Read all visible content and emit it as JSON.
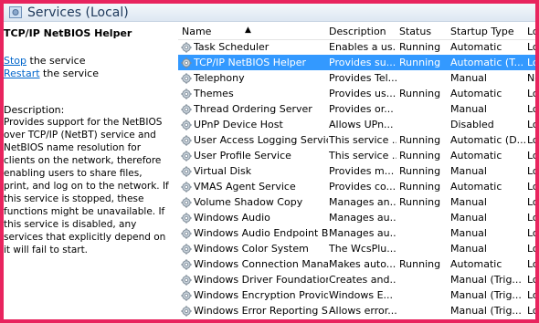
{
  "window": {
    "title": "Services (Local)"
  },
  "selected_service": {
    "name": "TCP/IP NetBIOS Helper",
    "action_stop_link": "Stop",
    "action_stop_suffix": " the service",
    "action_restart_link": "Restart",
    "action_restart_suffix": " the service",
    "description_heading": "Description:",
    "description": "Provides support for the NetBIOS over TCP/IP (NetBT) service and NetBIOS name resolution for clients on the network, therefore enabling users to share files, print, and log on to the network. If this service is stopped, these functions might be unavailable. If this service is disabled, any services that explicitly depend on it will fail to start."
  },
  "columns": {
    "name": "Name",
    "description": "Description",
    "status": "Status",
    "startup_type": "Startup Type",
    "log_on_as": "Lo"
  },
  "rows": [
    {
      "name": "Task Scheduler",
      "description": "Enables a us...",
      "status": "Running",
      "startup": "Automatic",
      "logon": "Lo"
    },
    {
      "name": "TCP/IP NetBIOS Helper",
      "description": "Provides su...",
      "status": "Running",
      "startup": "Automatic (T...",
      "logon": "Lo",
      "selected": true
    },
    {
      "name": "Telephony",
      "description": "Provides Tel...",
      "status": "",
      "startup": "Manual",
      "logon": "Ne"
    },
    {
      "name": "Themes",
      "description": "Provides us...",
      "status": "Running",
      "startup": "Automatic",
      "logon": "Lo"
    },
    {
      "name": "Thread Ordering Server",
      "description": "Provides or...",
      "status": "",
      "startup": "Manual",
      "logon": "Lo"
    },
    {
      "name": "UPnP Device Host",
      "description": "Allows UPn...",
      "status": "",
      "startup": "Disabled",
      "logon": "Lo"
    },
    {
      "name": "User Access Logging Service",
      "description": "This service ...",
      "status": "Running",
      "startup": "Automatic (D...",
      "logon": "Lo"
    },
    {
      "name": "User Profile Service",
      "description": "This service ...",
      "status": "Running",
      "startup": "Automatic",
      "logon": "Lo"
    },
    {
      "name": "Virtual Disk",
      "description": "Provides m...",
      "status": "Running",
      "startup": "Manual",
      "logon": "Lo"
    },
    {
      "name": "VMAS Agent Service",
      "description": "Provides co...",
      "status": "Running",
      "startup": "Automatic",
      "logon": "Lo"
    },
    {
      "name": "Volume Shadow Copy",
      "description": "Manages an...",
      "status": "Running",
      "startup": "Manual",
      "logon": "Lo"
    },
    {
      "name": "Windows Audio",
      "description": "Manages au...",
      "status": "",
      "startup": "Manual",
      "logon": "Lo"
    },
    {
      "name": "Windows Audio Endpoint B...",
      "description": "Manages au...",
      "status": "",
      "startup": "Manual",
      "logon": "Lo"
    },
    {
      "name": "Windows Color System",
      "description": "The WcsPlu...",
      "status": "",
      "startup": "Manual",
      "logon": "Lo"
    },
    {
      "name": "Windows Connection Mana...",
      "description": "Makes auto...",
      "status": "Running",
      "startup": "Automatic",
      "logon": "Lo"
    },
    {
      "name": "Windows Driver Foundation...",
      "description": "Creates and...",
      "status": "",
      "startup": "Manual (Trig...",
      "logon": "Lo"
    },
    {
      "name": "Windows Encryption Provid...",
      "description": "Windows E...",
      "status": "",
      "startup": "Manual (Trig...",
      "logon": "Lo"
    },
    {
      "name": "Windows Error Reporting Se...",
      "description": "Allows error...",
      "status": "",
      "startup": "Manual (Trig...",
      "logon": "Lo"
    }
  ]
}
